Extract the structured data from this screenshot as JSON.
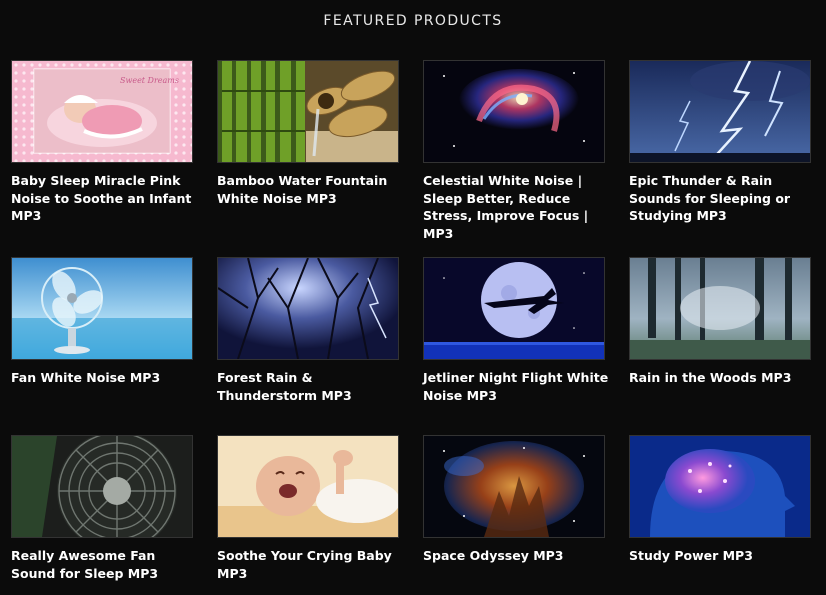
{
  "section": {
    "heading": "FEATURED PRODUCTS"
  },
  "products": [
    {
      "title": "Baby Sleep Miracle Pink Noise to Soothe an Infant MP3",
      "image_text": "Sweet Dreams"
    },
    {
      "title": "Bamboo Water Fountain White Noise MP3"
    },
    {
      "title": "Celestial White Noise | Sleep Better, Reduce Stress, Improve Focus | MP3"
    },
    {
      "title": "Epic Thunder & Rain Sounds for Sleeping or Studying MP3"
    },
    {
      "title": "Fan White Noise MP3"
    },
    {
      "title": "Forest Rain & Thunderstorm MP3"
    },
    {
      "title": "Jetliner Night Flight White Noise MP3"
    },
    {
      "title": "Rain in the Woods MP3"
    },
    {
      "title": "Really Awesome Fan Sound for Sleep MP3"
    },
    {
      "title": "Soothe Your Crying Baby MP3"
    },
    {
      "title": "Space Odyssey MP3"
    },
    {
      "title": "Study Power MP3"
    }
  ]
}
